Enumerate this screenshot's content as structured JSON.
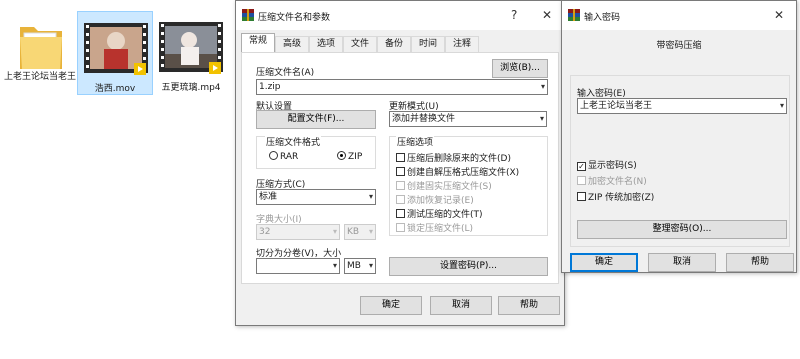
{
  "explorer": {
    "files": [
      {
        "name": "上老王论坛当老王",
        "type": "folder"
      },
      {
        "name": "浩西.mov",
        "type": "video",
        "selected": true
      },
      {
        "name": "五更琉璃.mp4",
        "type": "video"
      }
    ]
  },
  "archive_dialog": {
    "title": "压缩文件名和参数",
    "help_glyph": "?",
    "close_glyph": "✕",
    "tabs": [
      "常规",
      "高级",
      "选项",
      "文件",
      "备份",
      "时间",
      "注释"
    ],
    "archive_name_label": "压缩文件名(A)",
    "archive_name_value": "1.zip",
    "browse_button": "浏览(B)...",
    "default_settings_label": "默认设置",
    "profile_button": "配置文件(F)...",
    "update_mode_label": "更新模式(U)",
    "update_mode_value": "添加并替换文件",
    "format_group": "压缩文件格式",
    "format_rar": "RAR",
    "format_zip": "ZIP",
    "method_label": "压缩方式(C)",
    "method_value": "标准",
    "dict_label": "字典大小(I)",
    "dict_value": "32",
    "dict_unit": "KB",
    "split_label": "切分为分卷(V)，大小",
    "split_value": "",
    "split_unit": "MB",
    "options_group": "压缩选项",
    "options": [
      {
        "label": "压缩后删除原来的文件(D)",
        "checked": false,
        "enabled": true
      },
      {
        "label": "创建自解压格式压缩文件(X)",
        "checked": false,
        "enabled": true
      },
      {
        "label": "创建固实压缩文件(S)",
        "checked": false,
        "enabled": false
      },
      {
        "label": "添加恢复记录(E)",
        "checked": false,
        "enabled": false
      },
      {
        "label": "测试压缩的文件(T)",
        "checked": false,
        "enabled": true
      },
      {
        "label": "锁定压缩文件(L)",
        "checked": false,
        "enabled": false
      }
    ],
    "set_password_button": "设置密码(P)...",
    "ok": "确定",
    "cancel": "取消",
    "help": "帮助"
  },
  "password_dialog": {
    "title": "输入密码",
    "close_glyph": "✕",
    "heading": "带密码压缩",
    "password_label": "输入密码(E)",
    "password_value": "上老王论坛当老王",
    "show_password": "显示密码(S)",
    "encrypt_names": "加密文件名(N)",
    "zip_legacy": "ZIP 传统加密(Z)",
    "organize_button": "整理密码(O)...",
    "ok": "确定",
    "cancel": "取消",
    "help": "帮助"
  },
  "colors": {
    "accent": "#0078d7",
    "selection": "#cce8ff",
    "dialog_bg": "#f0f0f0"
  }
}
